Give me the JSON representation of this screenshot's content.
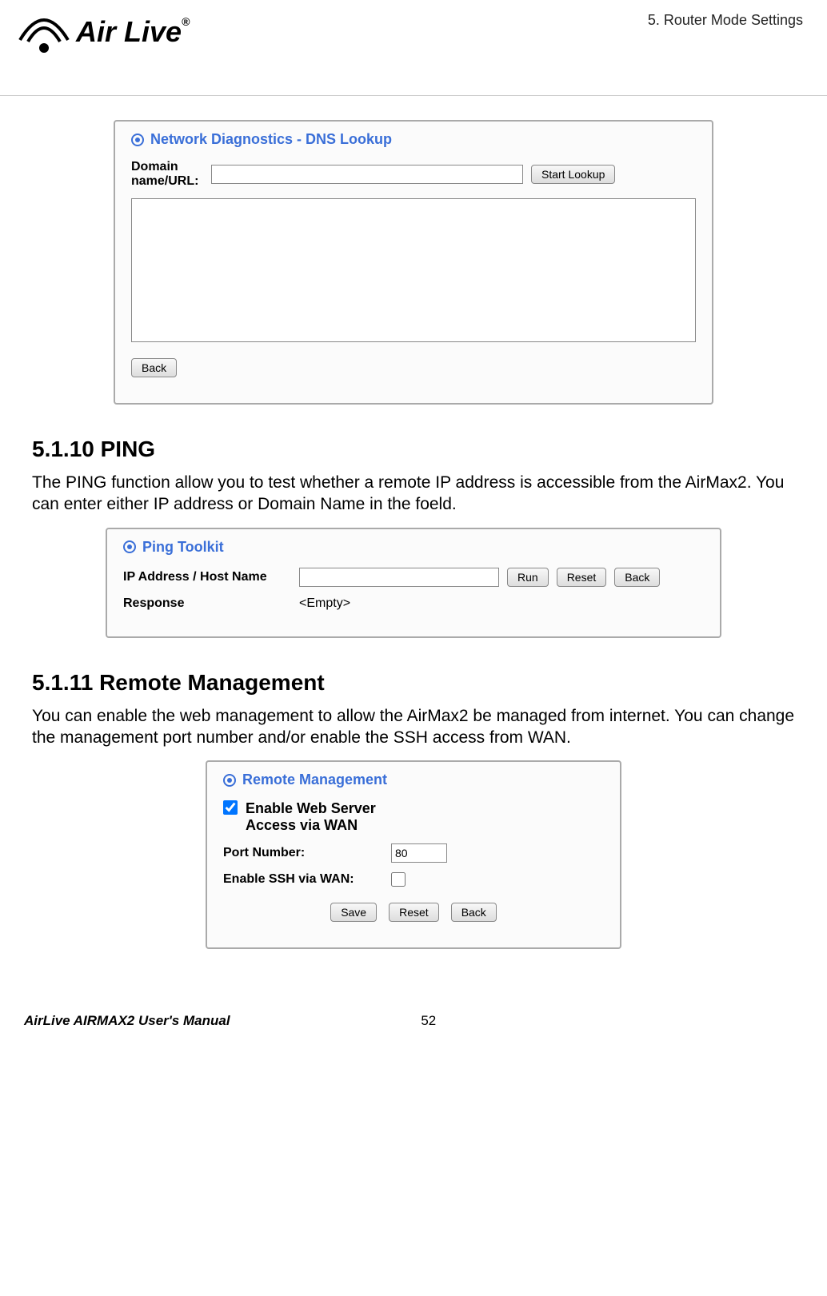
{
  "header": {
    "chapter": "5.  Router Mode Settings",
    "logo_text": "Air Live",
    "logo_r": "®"
  },
  "dns_panel": {
    "title": "Network Diagnostics - DNS Lookup",
    "domain_label": "Domain name/URL:",
    "domain_value": "",
    "start_lookup": "Start Lookup",
    "results": "",
    "back": "Back"
  },
  "ping_section": {
    "heading": "5.1.10 PING",
    "para": "The PING function allow you to test whether a remote IP address is accessible from the AirMax2.   You can enter either IP address or Domain Name in the foeld."
  },
  "ping_panel": {
    "title": "Ping Toolkit",
    "ip_label": "IP Address / Host Name",
    "ip_value": "",
    "run": "Run",
    "reset": "Reset",
    "back": "Back",
    "response_label": "Response",
    "response_value": "<Empty>"
  },
  "remote_section": {
    "heading": "5.1.11 Remote Management",
    "para": "You can enable the web management to allow the AirMax2 be managed from internet.   You can change the management port number and/or enable the SSH access from WAN."
  },
  "remote_panel": {
    "title": "Remote Management",
    "enable_web_label": "Enable Web Server Access via WAN",
    "enable_web_checked": true,
    "port_label": "Port Number:",
    "port_value": "80",
    "ssh_label": "Enable SSH via WAN:",
    "ssh_checked": false,
    "save": "Save",
    "reset": "Reset",
    "back": "Back"
  },
  "footer": {
    "manual": "AirLive AIRMAX2 User's Manual",
    "page": "52"
  }
}
